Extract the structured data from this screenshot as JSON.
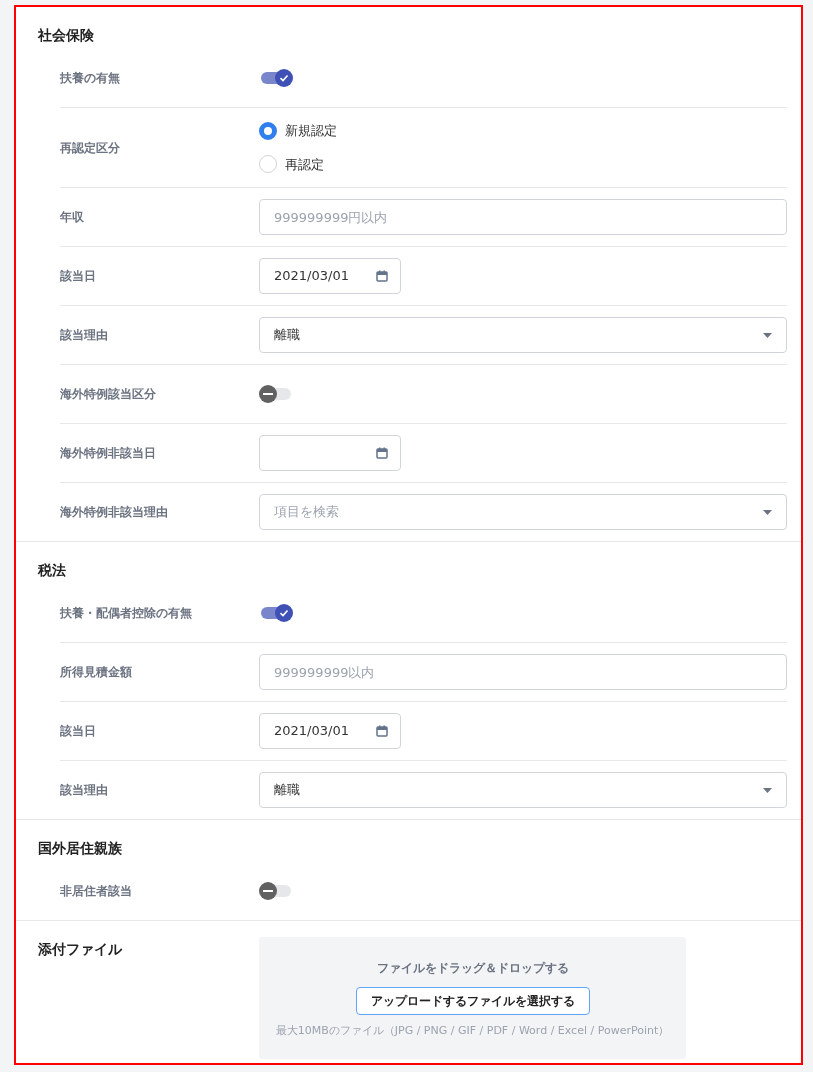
{
  "sections": [
    {
      "title": "社会保険",
      "rows": [
        {
          "kind": "toggle",
          "label": "扶養の有無",
          "on": true
        },
        {
          "kind": "radio",
          "label": "再認定区分",
          "options": [
            {
              "label": "新規認定",
              "selected": true
            },
            {
              "label": "再認定",
              "selected": false
            }
          ]
        },
        {
          "kind": "text",
          "label": "年収",
          "placeholder": "999999999円以内"
        },
        {
          "kind": "date",
          "label": "該当日",
          "value": "2021/03/01"
        },
        {
          "kind": "select",
          "label": "該当理由",
          "value": "離職"
        },
        {
          "kind": "toggle",
          "label": "海外特例該当区分",
          "on": false
        },
        {
          "kind": "date",
          "label": "海外特例非該当日"
        },
        {
          "kind": "select",
          "label": "海外特例非該当理由",
          "placeholder": "項目を検索"
        }
      ]
    },
    {
      "title": "税法",
      "rows": [
        {
          "kind": "toggle",
          "label": "扶養・配偶者控除の有無",
          "on": true
        },
        {
          "kind": "text",
          "label": "所得見積金額",
          "placeholder": "999999999以内"
        },
        {
          "kind": "date",
          "label": "該当日",
          "value": "2021/03/01"
        },
        {
          "kind": "select",
          "label": "該当理由",
          "value": "離職"
        }
      ]
    },
    {
      "title": "国外居住親族",
      "rows": [
        {
          "kind": "toggle",
          "label": "非居住者該当",
          "on": false
        }
      ]
    }
  ],
  "attachment": {
    "title": "添付ファイル",
    "drop_hint": "ファイルをドラッグ＆ドロップする",
    "button": "アップロードするファイルを選択する",
    "note": "最大10MBのファイル（JPG / PNG / GIF / PDF / Word / Excel / PowerPoint）"
  }
}
